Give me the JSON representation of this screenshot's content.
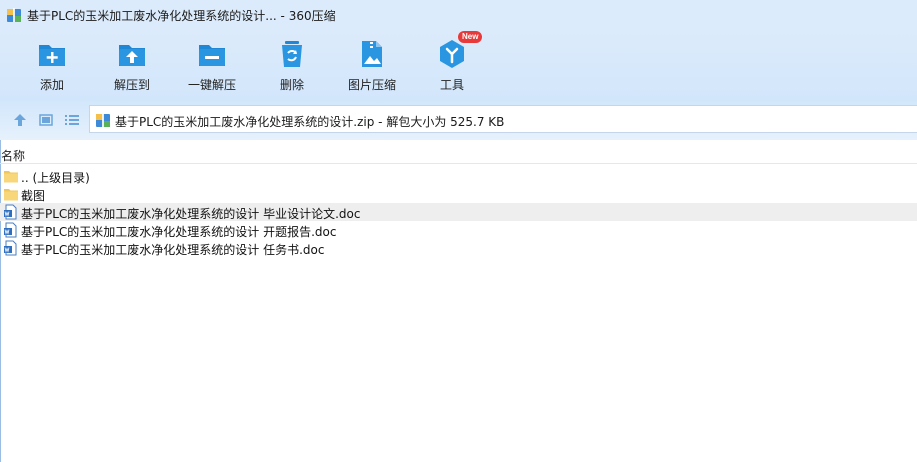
{
  "window": {
    "title": "基于PLC的玉米加工废水净化处理系统的设计... - 360压缩",
    "app_icon": "archive-icon"
  },
  "toolbar": {
    "items": [
      {
        "label": "添加",
        "icon": "add-folder-icon"
      },
      {
        "label": "解压到",
        "icon": "extract-folder-icon"
      },
      {
        "label": "一键解压",
        "icon": "one-click-extract-icon"
      },
      {
        "label": "删除",
        "icon": "recycle-bin-icon"
      },
      {
        "label": "图片压缩",
        "icon": "image-compress-icon"
      },
      {
        "label": "工具",
        "icon": "tools-cube-icon",
        "badge": "New"
      }
    ]
  },
  "address_bar": {
    "path": "基于PLC的玉米加工废水净化处理系统的设计.zip - 解包大小为 525.7 KB"
  },
  "columns": {
    "name": "名称"
  },
  "files": [
    {
      "name": ".. (上级目录)",
      "type": "folder"
    },
    {
      "name": "截图",
      "type": "folder"
    },
    {
      "name": "基于PLC的玉米加工废水净化处理系统的设计 毕业设计论文.doc",
      "type": "doc",
      "selected": true
    },
    {
      "name": "基于PLC的玉米加工废水净化处理系统的设计 开题报告.doc",
      "type": "doc"
    },
    {
      "name": "基于PLC的玉米加工废水净化处理系统的设计 任务书.doc",
      "type": "doc"
    }
  ],
  "colors": {
    "toolbar_bg": "#dcebfb",
    "icon_blue": "#1e88d6",
    "badge_red": "#e83a3a",
    "selection": "#eeeeee"
  }
}
